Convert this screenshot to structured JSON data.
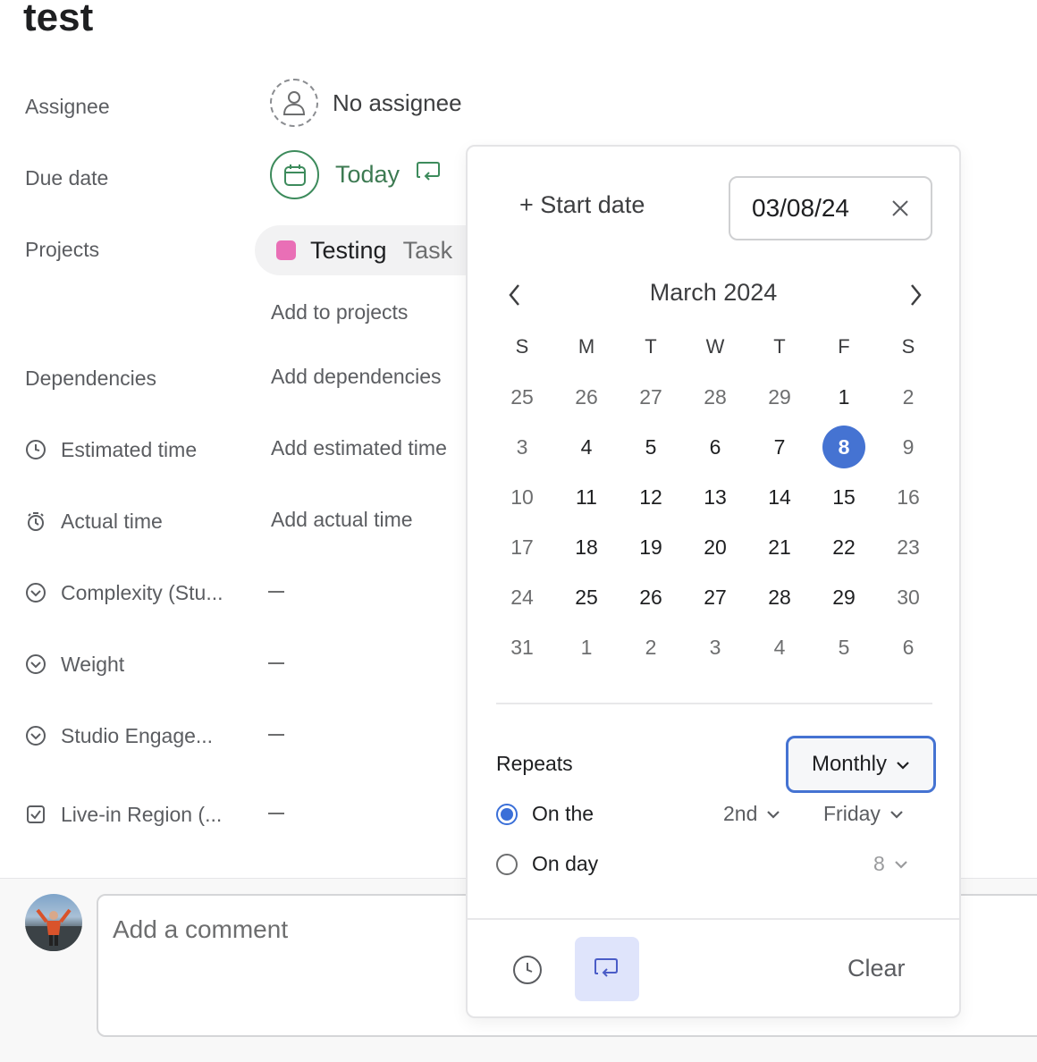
{
  "task": {
    "title": "test"
  },
  "fields": {
    "assignee": {
      "label": "Assignee",
      "value": "No assignee"
    },
    "due_date": {
      "label": "Due date",
      "value": "Today"
    },
    "projects": {
      "label": "Projects",
      "project_name": "Testing",
      "section": "Task",
      "add_label": "Add to projects"
    },
    "dependencies": {
      "label": "Dependencies",
      "value": "Add dependencies"
    },
    "estimated_time": {
      "label": "Estimated time",
      "value": "Add estimated time"
    },
    "actual_time": {
      "label": "Actual time",
      "value": "Add actual time"
    },
    "custom": [
      {
        "label": "Complexity (Stu...",
        "icon": "chevron-circle-icon"
      },
      {
        "label": "Weight",
        "icon": "chevron-circle-icon"
      },
      {
        "label": "Studio Engage...",
        "icon": "chevron-circle-icon"
      },
      {
        "label": "Live-in Region (...",
        "icon": "checkbox-icon"
      }
    ]
  },
  "comment": {
    "placeholder": "Add a comment"
  },
  "date_picker": {
    "start_date_label": "+ Start date",
    "date_value": "03/08/24",
    "month_label": "March 2024",
    "weekdays": [
      "S",
      "M",
      "T",
      "W",
      "T",
      "F",
      "S"
    ],
    "weeks": [
      [
        "25",
        "26",
        "27",
        "28",
        "29",
        "1",
        "2"
      ],
      [
        "3",
        "4",
        "5",
        "6",
        "7",
        "8",
        "9"
      ],
      [
        "10",
        "11",
        "12",
        "13",
        "14",
        "15",
        "16"
      ],
      [
        "17",
        "18",
        "19",
        "20",
        "21",
        "22",
        "23"
      ],
      [
        "24",
        "25",
        "26",
        "27",
        "28",
        "29",
        "30"
      ],
      [
        "31",
        "1",
        "2",
        "3",
        "4",
        "5",
        "6"
      ]
    ],
    "selected_day": "8",
    "repeats_label": "Repeats",
    "frequency": "Monthly",
    "option_on_the": "On the",
    "ordinal": "2nd",
    "weekday_choice": "Friday",
    "option_on_day": "On day",
    "day_choice": "8",
    "clear_label": "Clear"
  },
  "colors": {
    "accent": "#4573d2",
    "due_green": "#3d7a52",
    "project_pink": "#e96fb6"
  }
}
